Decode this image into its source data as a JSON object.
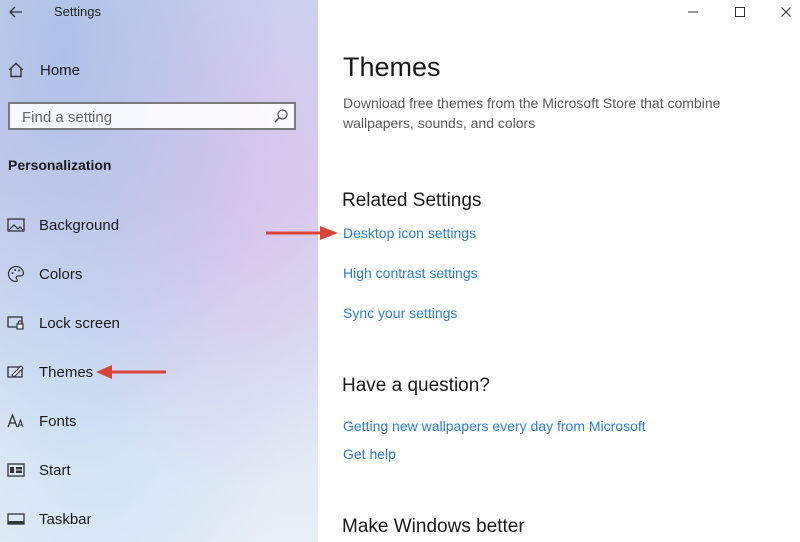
{
  "window": {
    "title": "Settings",
    "controls": [
      "minimize",
      "maximize",
      "close"
    ]
  },
  "sidebar": {
    "home_label": "Home",
    "search": {
      "placeholder": "Find a setting"
    },
    "section_title": "Personalization",
    "items": [
      {
        "label": "Background",
        "icon": "picture-icon"
      },
      {
        "label": "Colors",
        "icon": "palette-icon"
      },
      {
        "label": "Lock screen",
        "icon": "lock-screen-icon"
      },
      {
        "label": "Themes",
        "icon": "brush-icon"
      },
      {
        "label": "Fonts",
        "icon": "fonts-icon"
      },
      {
        "label": "Start",
        "icon": "start-icon"
      },
      {
        "label": "Taskbar",
        "icon": "taskbar-icon"
      }
    ]
  },
  "main": {
    "title": "Themes",
    "description": "Download free themes from the Microsoft Store that combine wallpapers, sounds, and colors",
    "related_settings": {
      "heading": "Related Settings",
      "links": [
        "Desktop icon settings",
        "High contrast settings",
        "Sync your settings"
      ]
    },
    "question": {
      "heading": "Have a question?",
      "links": [
        "Getting new wallpapers every day from Microsoft",
        "Get help"
      ]
    },
    "better": {
      "heading": "Make Windows better"
    }
  },
  "annotations": {
    "arrow_color": "#d9443a"
  },
  "colors": {
    "link": "#2a7fd4",
    "accent_arrow": "#d9443a"
  }
}
